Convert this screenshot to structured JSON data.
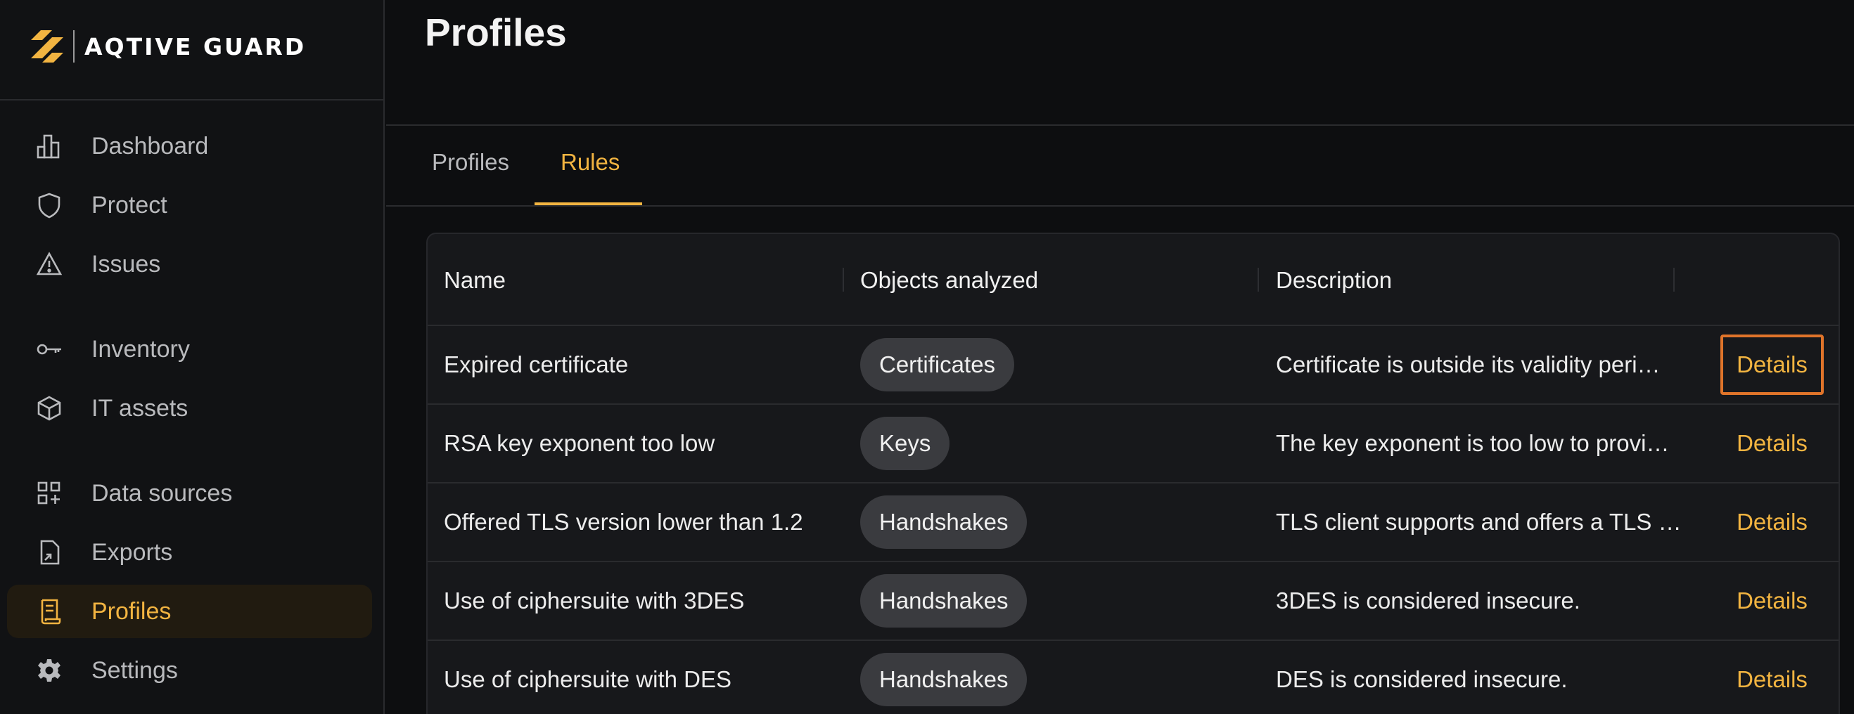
{
  "brand": {
    "name": "AQTIVE GUARD"
  },
  "colors": {
    "accent": "#f2b441",
    "focus_outline": "#e0742a",
    "background": "#0d0e10"
  },
  "sidebar": {
    "items": [
      {
        "label": "Dashboard",
        "icon": "bar-chart-icon"
      },
      {
        "label": "Protect",
        "icon": "shield-icon"
      },
      {
        "label": "Issues",
        "icon": "warning-triangle-icon"
      },
      {
        "label": "Inventory",
        "icon": "key-icon"
      },
      {
        "label": "IT assets",
        "icon": "cube-icon"
      },
      {
        "label": "Data sources",
        "icon": "grid-plus-icon"
      },
      {
        "label": "Exports",
        "icon": "file-export-icon"
      },
      {
        "label": "Profiles",
        "icon": "scroll-icon",
        "active": true
      },
      {
        "label": "Settings",
        "icon": "gear-icon"
      }
    ]
  },
  "page": {
    "title": "Profiles"
  },
  "tabs": [
    {
      "label": "Profiles",
      "active": false
    },
    {
      "label": "Rules",
      "active": true
    }
  ],
  "table": {
    "columns": [
      "Name",
      "Objects analyzed",
      "Description",
      ""
    ],
    "rows": [
      {
        "name": "Expired certificate",
        "objects": "Certificates",
        "description": "Certificate is outside its validity peri…",
        "action": "Details"
      },
      {
        "name": "RSA key exponent too low",
        "objects": "Keys",
        "description": "The key exponent is too low to provi…",
        "action": "Details"
      },
      {
        "name": "Offered TLS version lower than 1.2",
        "objects": "Handshakes",
        "description": "TLS client supports and offers a TLS …",
        "action": "Details"
      },
      {
        "name": "Use of ciphersuite with 3DES",
        "objects": "Handshakes",
        "description": "3DES is considered insecure.",
        "action": "Details"
      },
      {
        "name": "Use of ciphersuite with DES",
        "objects": "Handshakes",
        "description": "DES is considered insecure.",
        "action": "Details"
      }
    ]
  }
}
